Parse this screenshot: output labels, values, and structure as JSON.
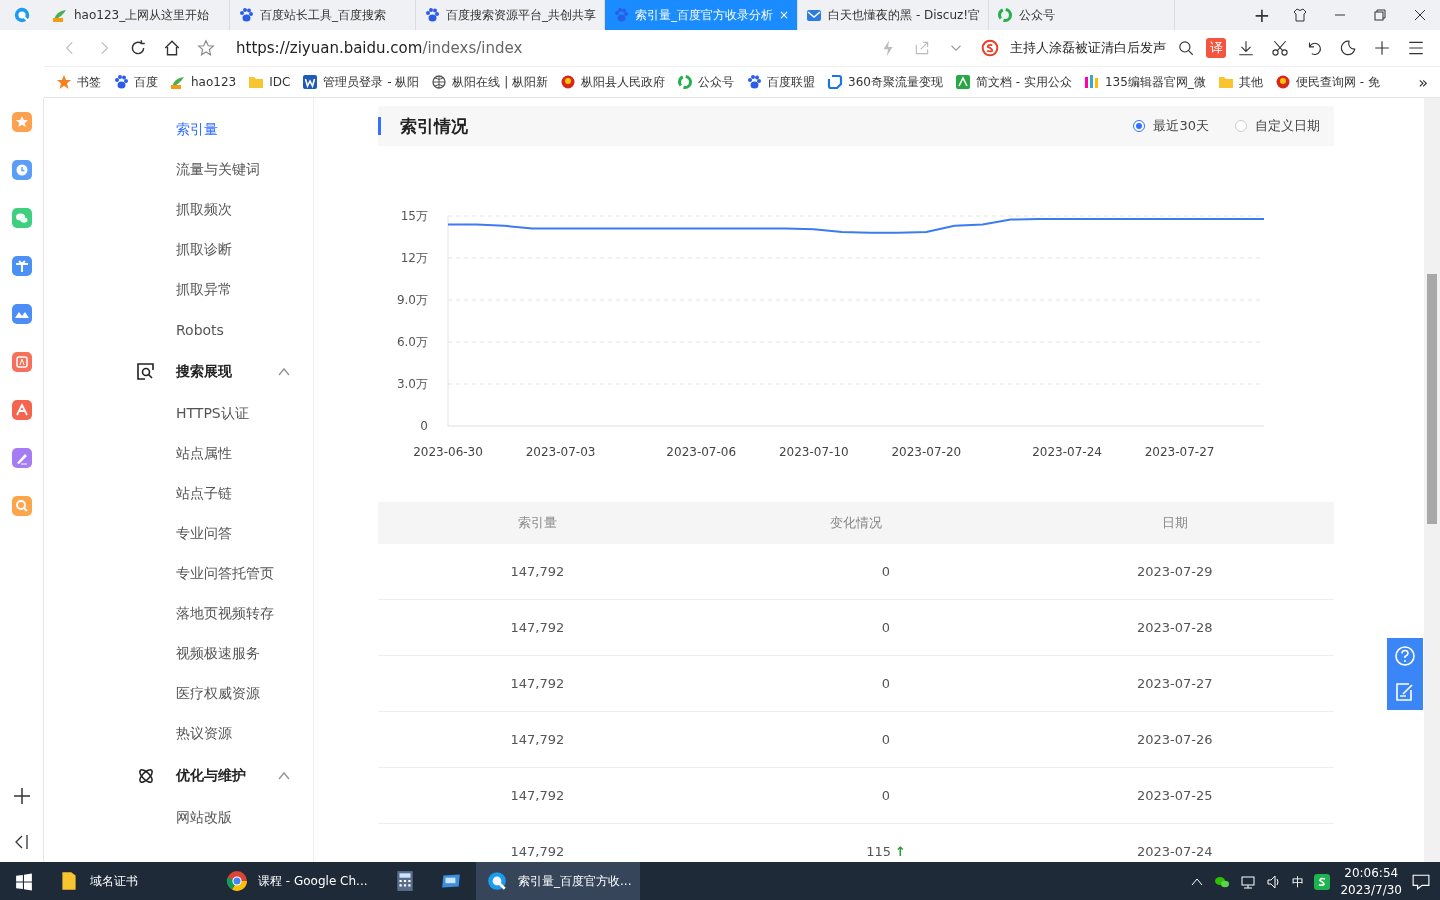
{
  "browser": {
    "tabs": [
      {
        "label": "hao123_上网从这里开始",
        "selected": false
      },
      {
        "label": "百度站长工具_百度搜索",
        "selected": false
      },
      {
        "label": "百度搜索资源平台_共创共享",
        "selected": false
      },
      {
        "label": "索引量_百度官方收录分析",
        "selected": true,
        "close": "×"
      },
      {
        "label": "白天也懂夜的黑 - Discuz!官",
        "selected": false
      },
      {
        "label": "公众号",
        "selected": false
      }
    ],
    "new_tab": "+",
    "url_host": "https://ziyuan.baidu.com",
    "url_path": "/indexs/index",
    "search_text": "主持人涂磊被证清白后发声",
    "translate": "译",
    "bookmarks": [
      "书签",
      "百度",
      "hao123",
      "IDC",
      "管理员登录 - 枞阳",
      "枞阳在线 | 枞阳新",
      "枞阳县人民政府",
      "公众号",
      "百度联盟",
      "360奇聚流量变现",
      "简文档 - 实用公众",
      "135编辑器官网_微",
      "其他",
      "便民查询网 - 免"
    ],
    "more": "»"
  },
  "nav": {
    "items": [
      {
        "label": "索引量",
        "selected": true
      },
      {
        "label": "流量与关键词",
        "selected": false
      },
      {
        "label": "抓取频次",
        "selected": false
      },
      {
        "label": "抓取诊断",
        "selected": false
      },
      {
        "label": "抓取异常",
        "selected": false
      },
      {
        "label": "Robots",
        "selected": false
      }
    ],
    "groups": [
      {
        "label": "搜索展现",
        "expanded": true,
        "items": [
          {
            "label": "HTTPS认证",
            "selected": false
          },
          {
            "label": "站点属性",
            "selected": false
          },
          {
            "label": "站点子链",
            "selected": false
          },
          {
            "label": "专业问答",
            "selected": false
          },
          {
            "label": "专业问答托管页",
            "selected": false
          },
          {
            "label": "落地页视频转存",
            "selected": false
          },
          {
            "label": "视频极速服务",
            "selected": false
          },
          {
            "label": "医疗权威资源",
            "selected": false
          },
          {
            "label": "热议资源",
            "selected": false
          }
        ]
      },
      {
        "label": "优化与维护",
        "expanded": true,
        "items": [
          {
            "label": "网站改版",
            "selected": false
          }
        ]
      }
    ]
  },
  "panel": {
    "title": "索引情况",
    "ranges": [
      {
        "label": "最近30天",
        "selected": true
      },
      {
        "label": "自定义日期",
        "selected": false
      }
    ],
    "chart_data": {
      "type": "line",
      "categories": [
        "2023-06-30",
        null,
        null,
        null,
        "2023-07-03",
        null,
        null,
        null,
        null,
        "2023-07-06",
        null,
        null,
        null,
        "2023-07-10",
        null,
        null,
        null,
        "2023-07-20",
        null,
        null,
        null,
        null,
        "2023-07-24",
        null,
        null,
        null,
        "2023-07-27",
        null,
        null,
        null
      ],
      "series": [
        {
          "color": "#3b7cf0",
          "values": [
            14.4,
            14.4,
            14.3,
            14.1,
            14.1,
            14.1,
            14.1,
            14.1,
            14.1,
            14.1,
            14.1,
            14.1,
            14.1,
            14.05,
            13.85,
            13.8,
            13.8,
            13.85,
            14.3,
            14.4,
            14.75,
            14.78,
            14.78,
            14.78,
            14.78,
            14.78,
            14.78,
            14.78,
            14.78,
            14.78
          ]
        }
      ],
      "ylim": [
        0,
        15
      ],
      "grid": true,
      "yticks": [
        {
          "value": 0,
          "label": "0"
        },
        {
          "value": 3,
          "label": "3.0万"
        },
        {
          "value": 6,
          "label": "6.0万"
        },
        {
          "value": 9,
          "label": "9.0万"
        },
        {
          "value": 12,
          "label": "12万"
        },
        {
          "value": 15,
          "label": "15万"
        }
      ]
    },
    "table": {
      "columns": [
        "索引量",
        "变化情况",
        "日期"
      ],
      "rows": [
        {
          "count": "147,792",
          "change": "0",
          "date": "2023-07-29"
        },
        {
          "count": "147,792",
          "change": "0",
          "date": "2023-07-28"
        },
        {
          "count": "147,792",
          "change": "0",
          "date": "2023-07-27"
        },
        {
          "count": "147,792",
          "change": "0",
          "date": "2023-07-26"
        },
        {
          "count": "147,792",
          "change": "0",
          "date": "2023-07-25"
        },
        {
          "count": "147,792",
          "change": "115",
          "arrow": "↑",
          "date": "2023-07-24"
        }
      ]
    }
  },
  "taskbar": {
    "apps": [
      {
        "label": "域名证书",
        "selected": false
      },
      {
        "label": "课程 - Google Ch...",
        "selected": false
      },
      {
        "selected": false
      },
      {
        "selected": false
      },
      {
        "label": "索引量_百度官方收...",
        "selected": true
      }
    ],
    "ime": "中",
    "time": "20:06:54",
    "date": "2023/7/30"
  }
}
